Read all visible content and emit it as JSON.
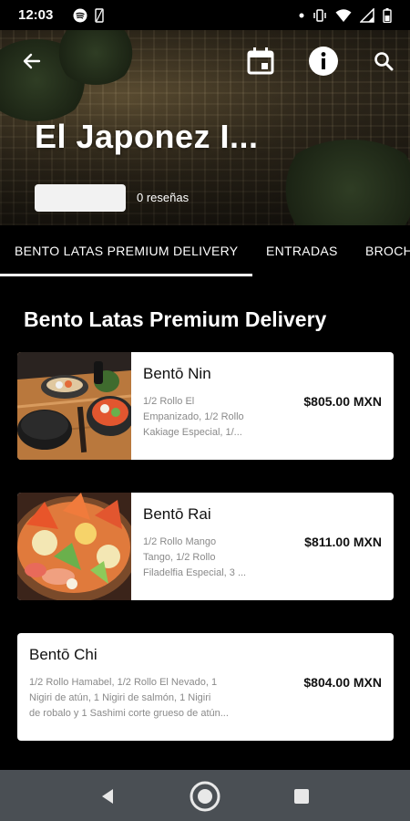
{
  "status_bar": {
    "time": "12:03",
    "left_icons": [
      "spotify-icon",
      "signal-placeholder-icon"
    ],
    "right_icons": [
      "dot-icon",
      "vibrate-icon",
      "wifi-icon",
      "signal-icon",
      "battery-icon"
    ]
  },
  "header": {
    "title": "El Japonez I...",
    "rating_placeholder": "",
    "reviews": "0 reseñas",
    "icons": [
      "back-arrow-icon",
      "calendar-icon",
      "info-icon",
      "search-icon"
    ]
  },
  "tabs": [
    {
      "label": "BENTO LATAS PREMIUM DELIVERY",
      "selected": true
    },
    {
      "label": "ENTRADAS",
      "selected": false
    },
    {
      "label": "BROCH",
      "selected": false
    }
  ],
  "section": {
    "title": "Bento Latas Premium Delivery"
  },
  "items": [
    {
      "name": "Bentō Nin",
      "desc1": "1/2 Rollo El",
      "desc2": "Empanizado, 1/2 Rollo",
      "desc3": "Kakiage Especial, 1/...",
      "price": "$805.00 MXN",
      "has_image": true
    },
    {
      "name": "Bentō Rai",
      "desc1": "1/2 Rollo Mango",
      "desc2": "Tango, 1/2 Rollo",
      "desc3": "Filadelfia Especial, 3 ...",
      "price": "$811.00 MXN",
      "has_image": true
    },
    {
      "name": "Bentō Chi",
      "desc1": "1/2 Rollo Hamabel, 1/2 Rollo El Nevado, 1",
      "desc2": "Nigiri de atún, 1 Nigiri de salmón, 1 Nigiri",
      "desc3": "de robalo y 1 Sashimi corte grueso de atún...",
      "price": "$804.00 MXN",
      "has_image": false
    }
  ],
  "nav_bar": {
    "icons": [
      "back-triangle-icon",
      "home-circle-icon",
      "recents-square-icon"
    ]
  }
}
